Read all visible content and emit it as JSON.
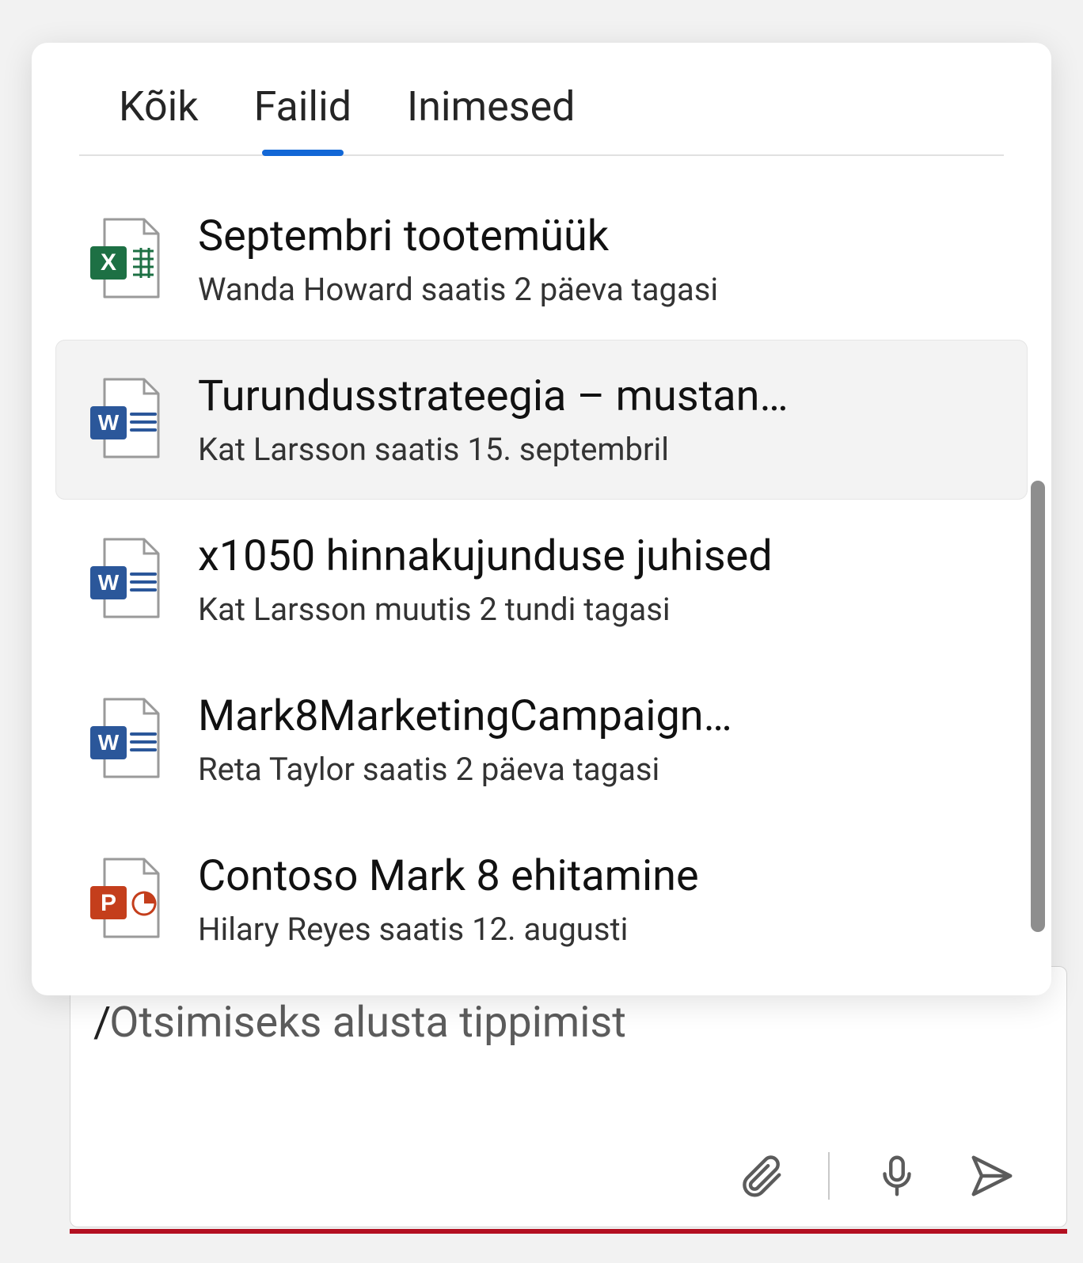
{
  "tabs": {
    "all": "Kõik",
    "files": "Failid",
    "people": "Inimesed"
  },
  "activeTab": "files",
  "colors": {
    "accent": "#1267d6",
    "excel": "#1d7044",
    "word": "#2b579a",
    "powerpoint": "#c43e1c",
    "dangerUnderline": "#b31021"
  },
  "results": [
    {
      "icon": "excel",
      "title": "Septembri tootemüük",
      "subtitle": "Wanda Howard saatis 2 päeva tagasi",
      "highlighted": false
    },
    {
      "icon": "word",
      "title": "Turundusstrateegia – mustan…",
      "subtitle": "Kat Larsson saatis 15. septembril",
      "highlighted": true
    },
    {
      "icon": "word",
      "title": "x1050 hinnakujunduse juhised",
      "subtitle": "Kat Larsson muutis 2 tundi tagasi",
      "highlighted": false
    },
    {
      "icon": "word",
      "title": "Mark8MarketingCampaign…",
      "subtitle": "Reta Taylor saatis 2 päeva tagasi",
      "highlighted": false
    },
    {
      "icon": "powerpoint",
      "title": "Contoso Mark 8 ehitamine",
      "subtitle": "Hilary Reyes saatis 12. augusti",
      "highlighted": false
    }
  ],
  "compose": {
    "prefix": "/",
    "placeholder": "Otsimiseks alusta tippimist"
  }
}
